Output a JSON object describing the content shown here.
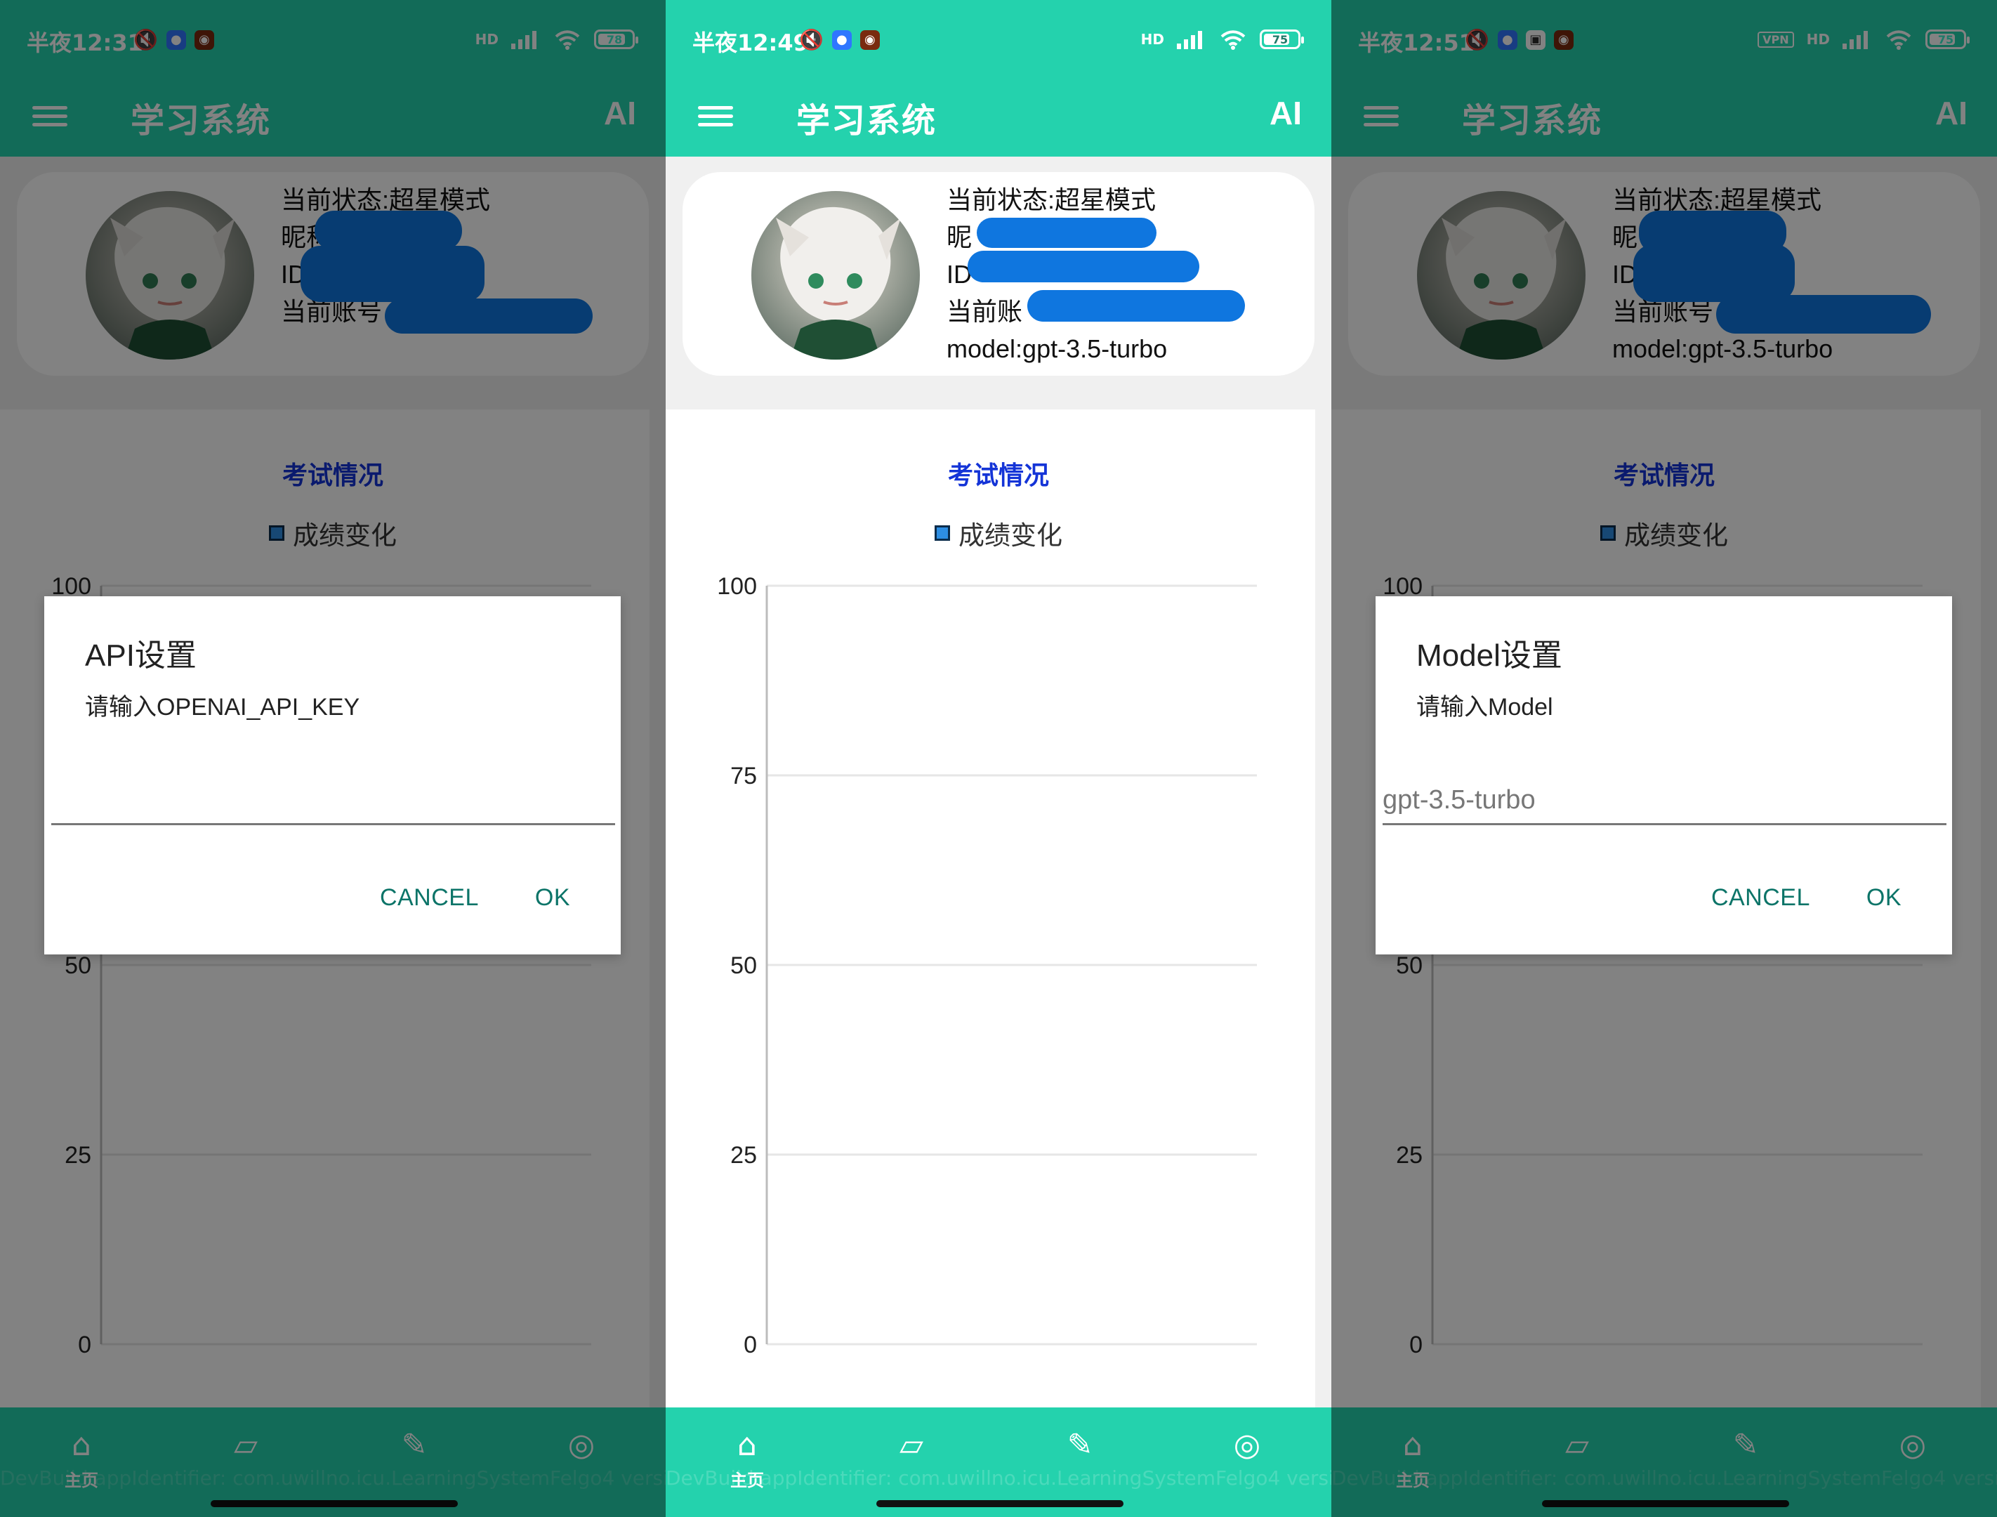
{
  "screens": [
    {
      "status_bar": {
        "time": "半夜12:31",
        "network": "HD",
        "battery": "78",
        "vpn": ""
      },
      "app_bar": {
        "title": "学习系统",
        "ai_label": "AI"
      },
      "profile": {
        "status_label": "当前状态:超星模式",
        "nickname_prefix": "昵称",
        "id_prefix": "ID:",
        "account_prefix": "当前账号",
        "model_label": ""
      },
      "dialog": {
        "title": "API设置",
        "message": "请输入OPENAI_API_KEY",
        "input_value": "",
        "cancel_label": "CANCEL",
        "ok_label": "OK"
      }
    },
    {
      "status_bar": {
        "time": "半夜12:49",
        "network": "HD",
        "battery": "75",
        "vpn": ""
      },
      "app_bar": {
        "title": "学习系统",
        "ai_label": "AI"
      },
      "profile": {
        "status_label": "当前状态:超星模式",
        "nickname_prefix": "昵",
        "id_prefix": "ID",
        "account_prefix": "当前账",
        "model_label": "model:gpt-3.5-turbo"
      },
      "dialog": null
    },
    {
      "status_bar": {
        "time": "半夜12:51",
        "network": "HD",
        "battery": "75",
        "vpn": "VPN"
      },
      "app_bar": {
        "title": "学习系统",
        "ai_label": "AI"
      },
      "profile": {
        "status_label": "当前状态:超星模式",
        "nickname_prefix": "昵",
        "id_prefix": "ID.",
        "account_prefix": "当前账号",
        "model_label": "model:gpt-3.5-turbo"
      },
      "dialog": {
        "title": "Model设置",
        "message": "请输入Model",
        "input_value": "",
        "input_placeholder": "gpt-3.5-turbo",
        "cancel_label": "CANCEL",
        "ok_label": "OK"
      }
    }
  ],
  "chart_data": [
    {
      "type": "line",
      "title": "考试情况",
      "xlabel": "",
      "ylabel": "",
      "ylim": [
        0,
        100
      ],
      "yticks": [
        0,
        25,
        50,
        75,
        100
      ],
      "series": [
        {
          "name": "成绩变化",
          "values": []
        }
      ],
      "legend": "top-center",
      "grid": true
    },
    {
      "type": "line",
      "title": "考试情况",
      "xlabel": "",
      "ylabel": "",
      "ylim": [
        0,
        100
      ],
      "yticks": [
        0,
        25,
        50,
        75,
        100
      ],
      "series": [
        {
          "name": "成绩变化",
          "values": []
        }
      ],
      "legend": "top-center",
      "grid": true
    },
    {
      "type": "line",
      "title": "考试情况",
      "xlabel": "",
      "ylabel": "",
      "ylim": [
        0,
        100
      ],
      "yticks": [
        0,
        25,
        50,
        75,
        100
      ],
      "series": [
        {
          "name": "成绩变化",
          "values": []
        }
      ],
      "legend": "top-center",
      "grid": true
    }
  ],
  "bottom_nav": {
    "home_label": "主页",
    "home_icon": "home-icon",
    "book_icon": "book-icon",
    "edit_icon": "pencil-icon",
    "chat_icon": "wechat-icon"
  },
  "watermark": "DevBuild appIdentifier: com.uwillno.icu.LearningSystemFelgo4 version: DevBuild appIdentifier: com.uwillno.icu.LearningSystemFelgo4",
  "colors": {
    "primary": "#24d2ad",
    "accent_button": "#0c7468",
    "chart_title": "#1434d7",
    "redaction": "#0f76df"
  }
}
